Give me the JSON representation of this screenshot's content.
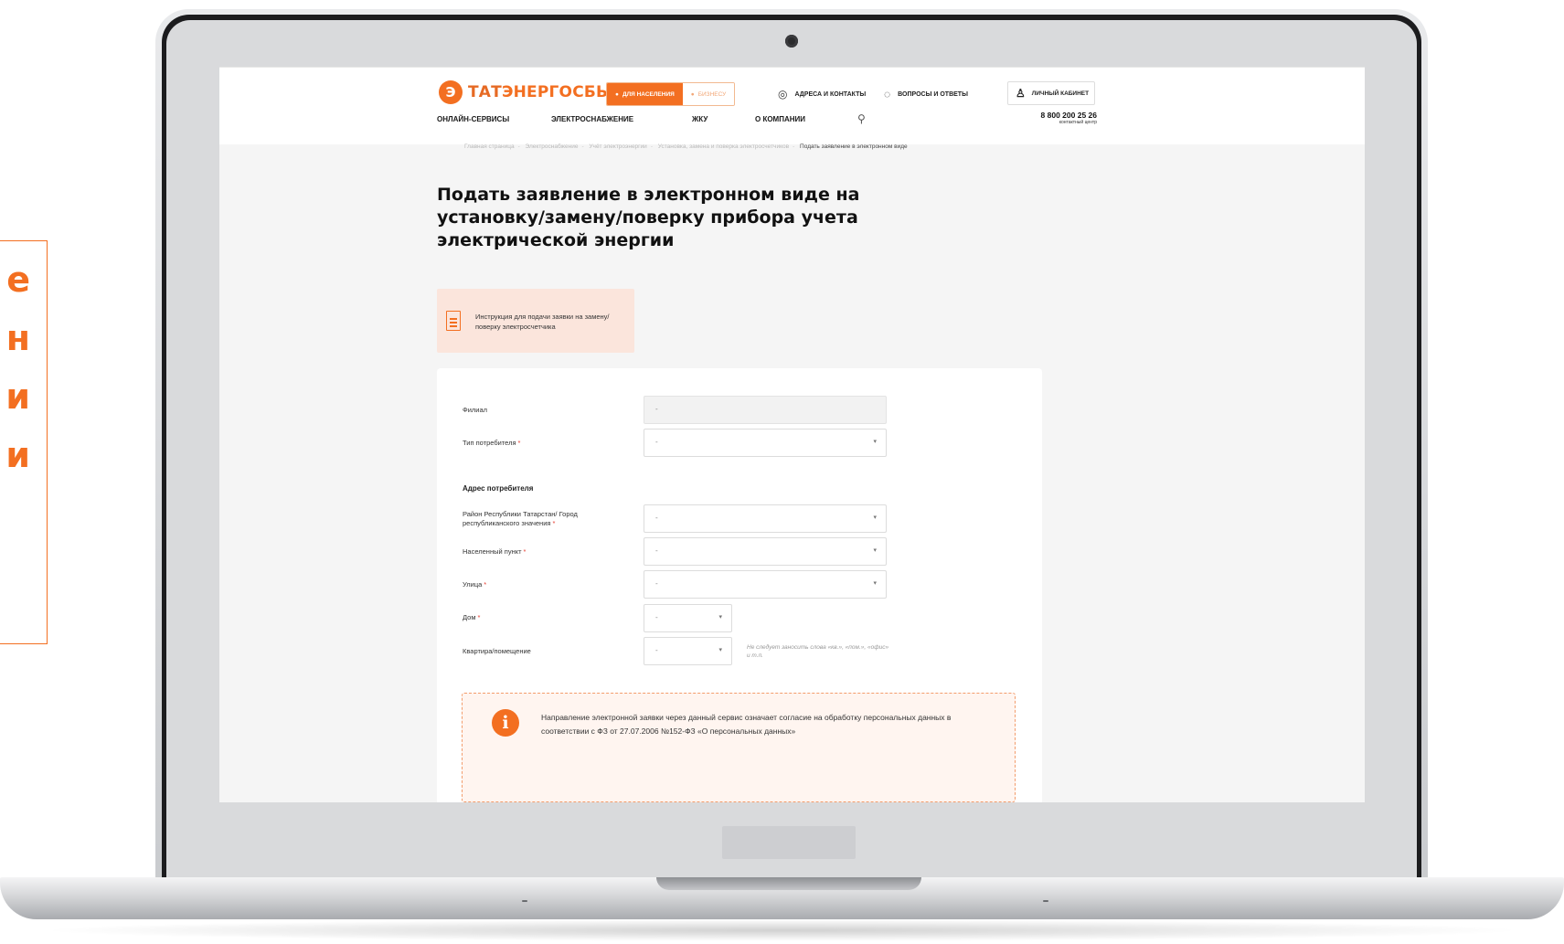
{
  "callout": {
    "chars": [
      "е",
      "н",
      "и",
      "и"
    ]
  },
  "header": {
    "logo": {
      "glyph": "Э",
      "text_a": "ТАТ",
      "text_b": "ЭНЕРГОСБЫТ"
    },
    "segment": {
      "active": "ДЛЯ НАСЕЛЕНИЯ",
      "inactive": "БИЗНЕСУ"
    },
    "links": [
      {
        "label": "АДРЕСА И КОНТАКТЫ",
        "icon": "location-pin-icon"
      },
      {
        "label": "ВОПРОСЫ И ОТВЕТЫ",
        "icon": "chat-bubbles-icon"
      }
    ],
    "cabinet": {
      "label": "ЛИЧНЫЙ КАБИНЕТ",
      "icon": "user-icon"
    },
    "nav": [
      "ОНЛАЙН-СЕРВИСЫ",
      "ЭЛЕКТРОСНАБЖЕНИЕ",
      "ЖКУ",
      "О КОМПАНИИ"
    ],
    "phone": "8 800 200 25 26",
    "phone_sub": "контактный центр"
  },
  "breadcrumbs": [
    "Главная страница",
    "Электроснабжение",
    "Учёт электроэнергии",
    "Установка, замена и поверка электросчетчиков",
    "Подать заявление в электронном виде"
  ],
  "page": {
    "title": "Подать заявление в электронном виде на установку/замену/поверку прибора учета электрической энергии"
  },
  "instruction": {
    "text": "Инструкция для подачи заявки на замену/поверку электросчетчика",
    "icon": "document-icon"
  },
  "form": {
    "filial": {
      "label": "Филиал",
      "value": "-"
    },
    "consumer_type": {
      "label": "Тип потребителя",
      "value": "-"
    },
    "address_section": "Адрес потребителя",
    "district": {
      "label": "Район Республики Татарстан/ Город республиканского значения",
      "value": "-"
    },
    "locality": {
      "label": "Населенный пункт",
      "value": "-"
    },
    "street": {
      "label": "Улица",
      "value": "-"
    },
    "house": {
      "label": "Дом",
      "value": "-"
    },
    "apartment": {
      "label": "Квартира/помещение",
      "value": "-"
    },
    "apartment_hint": "Не следует заносить слова «кв.», «пом.», «офис» и т.п.",
    "required_mark": "*"
  },
  "notice": {
    "icon": "info-icon",
    "glyph": "i",
    "text": "Направление электронной заявки через данный сервис означает согласие на обработку персональных данных в соответствии с ФЗ от 27.07.2006 №152-ФЗ «О персональных данных»"
  },
  "colors": {
    "accent": "#f36f21",
    "required": "#e63b2e"
  }
}
